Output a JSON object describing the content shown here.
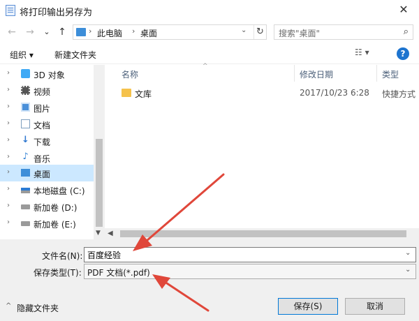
{
  "window": {
    "title": "将打印输出另存为",
    "close": "✕"
  },
  "nav": {
    "back": "←",
    "forward": "→",
    "history": "⌄",
    "up": "↑",
    "breadcrumb": [
      "此电脑",
      "桌面"
    ],
    "crumb_sep": "›",
    "dropdown": "⌄",
    "refresh": "↻",
    "search_placeholder": "搜索\"桌面\"",
    "search_icon": "⌕"
  },
  "toolbar": {
    "organize": "组织 ▾",
    "new_folder": "新建文件夹",
    "view_icon": "☷ ▾",
    "help": "?"
  },
  "sidebar": {
    "chevron": "›",
    "items": [
      {
        "label": "3D 对象",
        "icon": "cube-icon",
        "color": "#3fa9f5"
      },
      {
        "label": "视频",
        "icon": "film-icon",
        "color": "#555555"
      },
      {
        "label": "图片",
        "icon": "picture-icon",
        "color": "#4a90d9"
      },
      {
        "label": "文档",
        "icon": "document-icon",
        "color": "#7f9fbf"
      },
      {
        "label": "下载",
        "icon": "download-icon",
        "color": "#2f78d0"
      },
      {
        "label": "音乐",
        "icon": "music-icon",
        "color": "#3a86d6"
      },
      {
        "label": "桌面",
        "icon": "desktop-icon",
        "color": "#3d8ed9",
        "selected": true
      },
      {
        "label": "本地磁盘 (C:)",
        "icon": "windows-drive-icon",
        "color": "#7c7c7c"
      },
      {
        "label": "新加卷 (D:)",
        "icon": "drive-icon",
        "color": "#8a8a8a"
      },
      {
        "label": "新加卷 (E:)",
        "icon": "drive-icon",
        "color": "#8a8a8a"
      }
    ]
  },
  "filelist": {
    "columns": [
      "名称",
      "修改日期",
      "类型"
    ],
    "sort_arrow": "^",
    "rows": [
      {
        "name": "文库",
        "date": "2017/10/23 6:28",
        "type": "快捷方式"
      }
    ]
  },
  "form": {
    "filename_label": "文件名(N):",
    "filename_value": "百度经验",
    "filetype_label": "保存类型(T):",
    "filetype_value": "PDF 文档(*.pdf)",
    "dropdown": "⌄",
    "hide_folders": "隐藏文件夹",
    "hide_caret": "^",
    "save": "保存(S)",
    "cancel": "取消"
  },
  "colors": {
    "accent": "#0078d7",
    "selected": "#cce8ff",
    "arrow": "#e0473a",
    "folder": "#f5c24c"
  }
}
